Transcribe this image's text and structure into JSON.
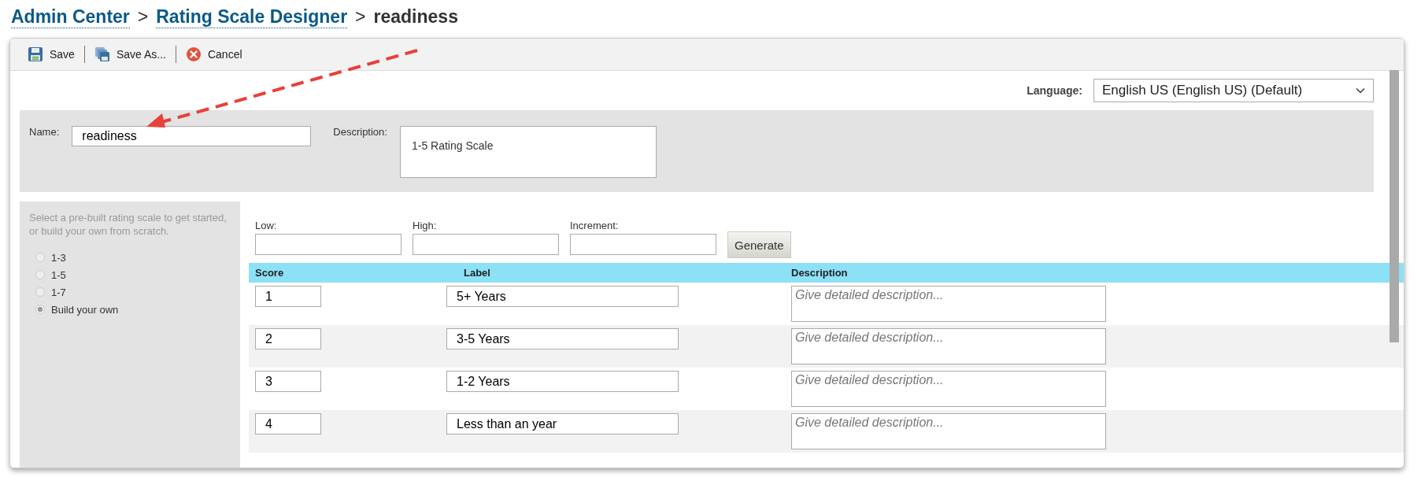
{
  "breadcrumb": [
    {
      "label": "Admin Center",
      "kind": "link"
    },
    {
      "label": "Rating Scale Designer",
      "kind": "link"
    },
    {
      "label": "readiness",
      "kind": "current"
    }
  ],
  "breadcrumb_separator": ">",
  "toolbar": [
    {
      "label": "Save",
      "kind": "save"
    },
    {
      "label": "Save As...",
      "kind": "save-as"
    },
    {
      "label": "Cancel",
      "kind": "cancel"
    }
  ],
  "language": {
    "label": "Language:",
    "value": "English US (English US) (Default)"
  },
  "name": {
    "label": "Name:",
    "value": "readiness"
  },
  "description": {
    "label": "Description:",
    "value": "1-5 Rating Scale"
  },
  "sidebar": {
    "hint": "Select a pre-built rating scale to get started, or build your own from scratch.",
    "options": [
      {
        "label": "1-3",
        "selected": false
      },
      {
        "label": "1-5",
        "selected": false
      },
      {
        "label": "1-7",
        "selected": false
      },
      {
        "label": "Build your own",
        "selected": true
      }
    ]
  },
  "generator": {
    "fields": [
      {
        "label": "Low:"
      },
      {
        "label": "High:"
      },
      {
        "label": "Increment:"
      }
    ],
    "button": "Generate"
  },
  "table": {
    "columns": [
      "Score",
      "Label",
      "Description"
    ],
    "rows": [
      {
        "score": "1",
        "label": "5+ Years",
        "placeholder": "Give detailed description..."
      },
      {
        "score": "2",
        "label": "3-5 Years",
        "placeholder": "Give detailed description..."
      },
      {
        "score": "3",
        "label": "1-2 Years",
        "placeholder": "Give detailed description..."
      },
      {
        "score": "4",
        "label": "Less than an year",
        "placeholder": "Give detailed description..."
      }
    ]
  }
}
